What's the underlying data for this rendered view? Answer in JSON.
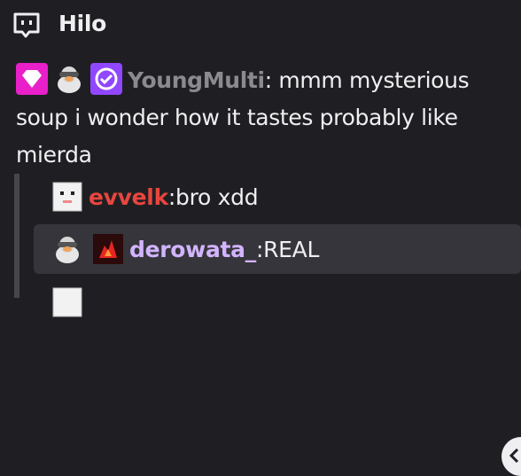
{
  "header": {
    "title": "Hilo",
    "icon": "chat-thread-icon"
  },
  "main_message": {
    "badges": [
      "prime-gaming-badge",
      "duck-badge",
      "verified-badge"
    ],
    "username": "YoungMulti",
    "separator": ":",
    "text": " mmm mysterious soup i wonder how it tastes probably like mierda"
  },
  "replies": [
    {
      "username": "evvelk",
      "separator": ":",
      "text": " bro xdd",
      "badges": [
        "pixel-face-avatar"
      ]
    },
    {
      "username": "derowata_",
      "separator": ":",
      "text": " REAL",
      "badges": [
        "duck-badge",
        "fire-emote-badge"
      ]
    },
    {
      "username": "",
      "separator": "",
      "text": "",
      "badges": [
        "pixel-face-avatar"
      ]
    }
  ],
  "colors": {
    "background": "#1f1f23",
    "evvelk": "#e8463f",
    "derowata": "#d2b4ff",
    "youngmulti": "#8b8b8f",
    "highlight_row": "#35353b"
  }
}
